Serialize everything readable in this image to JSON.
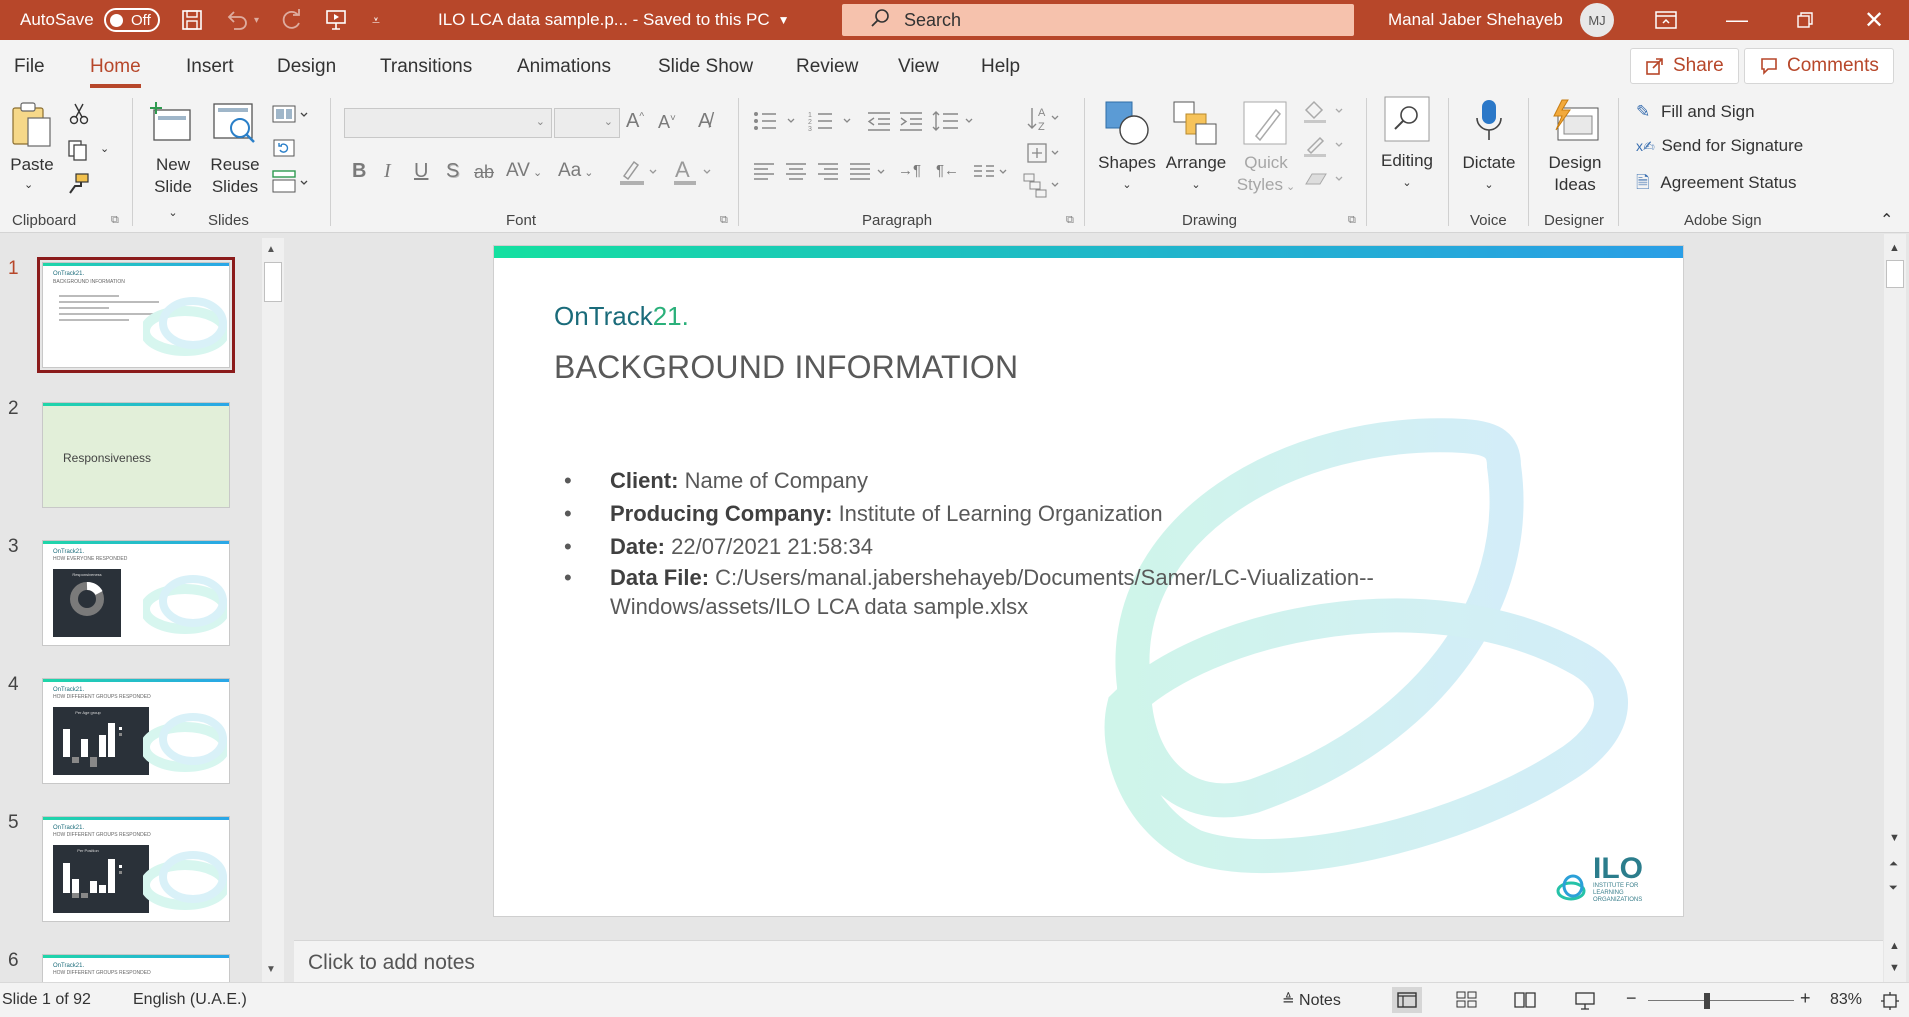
{
  "titlebar": {
    "autosave_label": "AutoSave",
    "autosave_state": "Off",
    "doc_title": "ILO LCA data sample.p...  -  Saved to this PC",
    "search_placeholder": "Search",
    "user_name": "Manal Jaber Shehayeb",
    "user_initials": "MJ"
  },
  "menu": {
    "tabs": [
      "File",
      "Home",
      "Insert",
      "Design",
      "Transitions",
      "Animations",
      "Slide Show",
      "Review",
      "View",
      "Help"
    ],
    "active_tab": "Home",
    "share_label": "Share",
    "comments_label": "Comments"
  },
  "ribbon": {
    "clipboard": {
      "label": "Clipboard",
      "paste": "Paste"
    },
    "slides": {
      "label": "Slides",
      "new_slide_1": "New",
      "new_slide_2": "Slide",
      "reuse_1": "Reuse",
      "reuse_2": "Slides"
    },
    "font": {
      "label": "Font",
      "bold": "B",
      "italic": "I",
      "underline": "U",
      "shadow": "S",
      "strike": "ab",
      "spacing": "AV",
      "case": "Aa"
    },
    "paragraph": {
      "label": "Paragraph"
    },
    "drawing": {
      "label": "Drawing",
      "shapes": "Shapes",
      "arrange": "Arrange",
      "quick_1": "Quick",
      "quick_2": "Styles"
    },
    "editing": {
      "label": "Editing"
    },
    "voice": {
      "label": "Voice",
      "dictate": "Dictate"
    },
    "designer": {
      "label": "Designer",
      "ideas_1": "Design",
      "ideas_2": "Ideas"
    },
    "adobe": {
      "label": "Adobe Sign",
      "fill_sign": "Fill and Sign",
      "send_sig": "Send for Signature",
      "agreement": "Agreement Status"
    }
  },
  "thumbnails": [
    {
      "num": "1",
      "title": "BACKGROUND INFORMATION",
      "selected": true
    },
    {
      "num": "2",
      "title": "Responsiveness",
      "selected": false
    },
    {
      "num": "3",
      "title": "HOW EVERYONE RESPONDED",
      "chart": "Responsiveness",
      "selected": false
    },
    {
      "num": "4",
      "title": "HOW DIFFERENT GROUPS RESPONDED",
      "chart": "Per Age group",
      "selected": false
    },
    {
      "num": "5",
      "title": "HOW DIFFERENT GROUPS RESPONDED",
      "chart": "Per Position",
      "selected": false
    },
    {
      "num": "6",
      "title": "HOW DIFFERENT GROUPS RESPONDED",
      "selected": false
    }
  ],
  "slide": {
    "logo_a": "OnTrack",
    "logo_b": "21.",
    "title": "BACKGROUND INFORMATION",
    "bullets": [
      {
        "label": "Client:",
        "value": " Name of Company"
      },
      {
        "label": "Producing Company:",
        "value": " Institute of Learning Organization"
      },
      {
        "label": "Date:",
        "value": " 22/07/2021 21:58:34"
      },
      {
        "label": "Data File:",
        "value": " C:/Users/manal.jabershehayeb/Documents/Samer/LC-Viualization--Windows/assets/ILO LCA data sample.xlsx"
      }
    ],
    "footer_logo": "ILO",
    "footer_sub": "INSTITUTE FOR LEARNING ORGANIZATIONS"
  },
  "notes_placeholder": "Click to add notes",
  "status": {
    "slide_of": "Slide 1 of 92",
    "language": "English (U.A.E.)",
    "notes": "Notes",
    "zoom": "83%"
  },
  "colors": {
    "accent": "#b7472a",
    "slide_text": "#595959",
    "teal": "#2b7d8c"
  }
}
